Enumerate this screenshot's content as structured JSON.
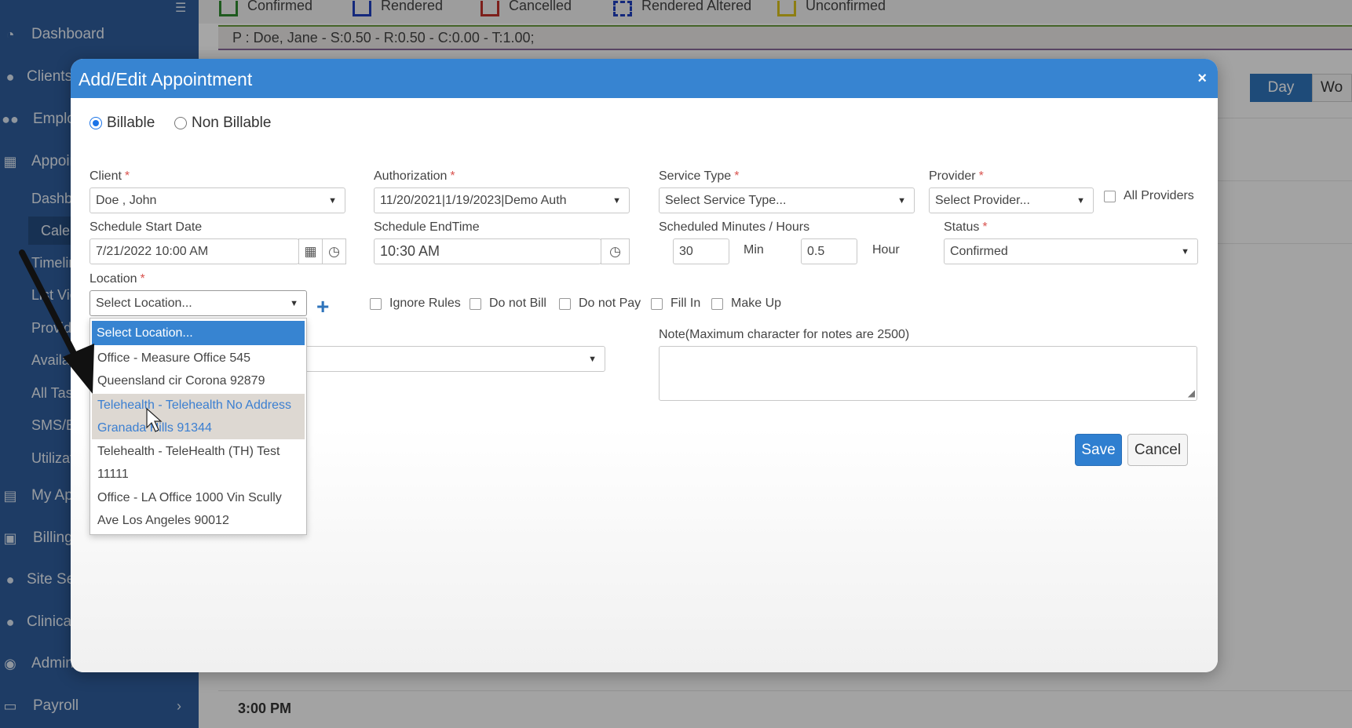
{
  "sidebar": {
    "items": [
      {
        "label": "Dashboard",
        "icon": "dashboard-icon"
      },
      {
        "label": "Clients",
        "icon": "user-icon"
      },
      {
        "label": "Employees",
        "icon": "users-icon"
      },
      {
        "label": "Appointments",
        "icon": "calendar-icon"
      },
      {
        "label": "Dashboard",
        "icon": ""
      },
      {
        "label": "Calendar",
        "icon": ""
      },
      {
        "label": "Timeline",
        "icon": ""
      },
      {
        "label": "List View",
        "icon": ""
      },
      {
        "label": "Provider",
        "icon": ""
      },
      {
        "label": "Availability",
        "icon": ""
      },
      {
        "label": "All Tasks",
        "icon": ""
      },
      {
        "label": "SMS/Email",
        "icon": ""
      },
      {
        "label": "Utilization",
        "icon": ""
      },
      {
        "label": "My Appointments",
        "icon": "file-icon"
      },
      {
        "label": "Billing",
        "icon": "money-icon"
      },
      {
        "label": "Site Settings",
        "icon": "user-icon"
      },
      {
        "label": "Clinical",
        "icon": "user-icon"
      },
      {
        "label": "Admin",
        "icon": "user-circle-icon"
      },
      {
        "label": "Payroll",
        "icon": "card-icon"
      }
    ],
    "payroll_chevron": "›"
  },
  "legend": {
    "items": [
      {
        "label": "Confirmed",
        "color": "#2e8b2e"
      },
      {
        "label": "Rendered",
        "color": "#1f3fbf"
      },
      {
        "label": "Cancelled",
        "color": "#c0302a"
      },
      {
        "label": "Rendered Altered",
        "color": "#1f3fbf"
      },
      {
        "label": "Unconfirmed",
        "color": "#d9c21c"
      }
    ]
  },
  "info_bar": "P : Doe, Jane - S:0.50 - R:0.50 - C:0.00 - T:1.00;",
  "calendar": {
    "view_day": "Day",
    "view_week": "Wo",
    "time_label": "3:00 PM"
  },
  "modal": {
    "title": "Add/Edit Appointment",
    "close": "×",
    "billable_label": "Billable",
    "non_billable_label": "Non Billable",
    "required_mark": "*",
    "client": {
      "label": "Client",
      "value": "Doe , John"
    },
    "authorization": {
      "label": "Authorization",
      "value": "11/20/2021|1/19/2023|Demo Auth"
    },
    "service_type": {
      "label": "Service Type",
      "value": "Select Service Type..."
    },
    "provider": {
      "label": "Provider",
      "value": "Select Provider..."
    },
    "all_providers": "All Providers",
    "start_date": {
      "label": "Schedule Start Date",
      "value": "7/21/2022 10:00 AM"
    },
    "end_time": {
      "label": "Schedule EndTime",
      "value": "10:30 AM"
    },
    "scheduled": {
      "label": "Scheduled Minutes / Hours",
      "minutes": "30",
      "min_unit": "Min",
      "hours": "0.5",
      "hour_unit": "Hour"
    },
    "status": {
      "label": "Status",
      "value": "Confirmed"
    },
    "location": {
      "label": "Location",
      "value": "Select Location..."
    },
    "checkboxes": {
      "ignore_rules": "Ignore Rules",
      "do_not_bill": "Do not Bill",
      "do_not_pay": "Do not Pay",
      "fill_in": "Fill In",
      "make_up": "Make Up"
    },
    "note_label": "Note(Maximum character for notes are 2500)",
    "save": "Save",
    "cancel": "Cancel",
    "location_dropdown": {
      "header": "Select Location...",
      "options": [
        {
          "line1": "Office - Measure Office 545",
          "line2": "Queensland cir Corona 92879"
        },
        {
          "line1": "Telehealth - Telehealth No Address",
          "line2": "Granada Hills 91344"
        },
        {
          "line1": "Telehealth - TeleHealth (TH) Test",
          "line2": "11111"
        },
        {
          "line1": "Office - LA Office 1000 Vin Scully",
          "line2": "Ave Los Angeles 90012"
        }
      ]
    }
  },
  "colors": {
    "sidebar": "#2e5d9b",
    "modal_header": "#3784d1",
    "primary_button": "#2f7fd0",
    "required": "#d9534f"
  }
}
